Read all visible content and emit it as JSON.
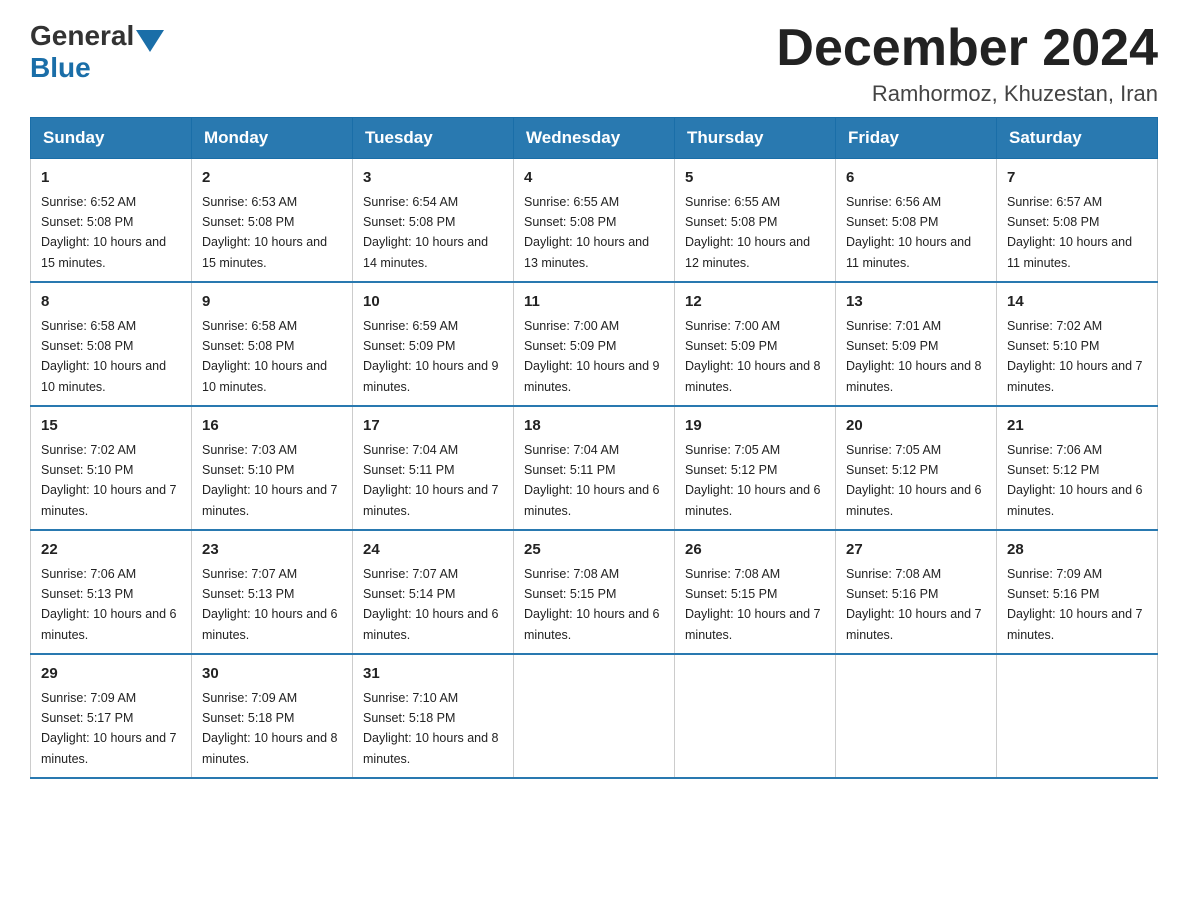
{
  "header": {
    "logo_general": "General",
    "logo_blue": "Blue",
    "title": "December 2024",
    "subtitle": "Ramhormoz, Khuzestan, Iran"
  },
  "weekdays": [
    "Sunday",
    "Monday",
    "Tuesday",
    "Wednesday",
    "Thursday",
    "Friday",
    "Saturday"
  ],
  "weeks": [
    [
      {
        "day": "1",
        "sunrise": "6:52 AM",
        "sunset": "5:08 PM",
        "daylight": "10 hours and 15 minutes."
      },
      {
        "day": "2",
        "sunrise": "6:53 AM",
        "sunset": "5:08 PM",
        "daylight": "10 hours and 15 minutes."
      },
      {
        "day": "3",
        "sunrise": "6:54 AM",
        "sunset": "5:08 PM",
        "daylight": "10 hours and 14 minutes."
      },
      {
        "day": "4",
        "sunrise": "6:55 AM",
        "sunset": "5:08 PM",
        "daylight": "10 hours and 13 minutes."
      },
      {
        "day": "5",
        "sunrise": "6:55 AM",
        "sunset": "5:08 PM",
        "daylight": "10 hours and 12 minutes."
      },
      {
        "day": "6",
        "sunrise": "6:56 AM",
        "sunset": "5:08 PM",
        "daylight": "10 hours and 11 minutes."
      },
      {
        "day": "7",
        "sunrise": "6:57 AM",
        "sunset": "5:08 PM",
        "daylight": "10 hours and 11 minutes."
      }
    ],
    [
      {
        "day": "8",
        "sunrise": "6:58 AM",
        "sunset": "5:08 PM",
        "daylight": "10 hours and 10 minutes."
      },
      {
        "day": "9",
        "sunrise": "6:58 AM",
        "sunset": "5:08 PM",
        "daylight": "10 hours and 10 minutes."
      },
      {
        "day": "10",
        "sunrise": "6:59 AM",
        "sunset": "5:09 PM",
        "daylight": "10 hours and 9 minutes."
      },
      {
        "day": "11",
        "sunrise": "7:00 AM",
        "sunset": "5:09 PM",
        "daylight": "10 hours and 9 minutes."
      },
      {
        "day": "12",
        "sunrise": "7:00 AM",
        "sunset": "5:09 PM",
        "daylight": "10 hours and 8 minutes."
      },
      {
        "day": "13",
        "sunrise": "7:01 AM",
        "sunset": "5:09 PM",
        "daylight": "10 hours and 8 minutes."
      },
      {
        "day": "14",
        "sunrise": "7:02 AM",
        "sunset": "5:10 PM",
        "daylight": "10 hours and 7 minutes."
      }
    ],
    [
      {
        "day": "15",
        "sunrise": "7:02 AM",
        "sunset": "5:10 PM",
        "daylight": "10 hours and 7 minutes."
      },
      {
        "day": "16",
        "sunrise": "7:03 AM",
        "sunset": "5:10 PM",
        "daylight": "10 hours and 7 minutes."
      },
      {
        "day": "17",
        "sunrise": "7:04 AM",
        "sunset": "5:11 PM",
        "daylight": "10 hours and 7 minutes."
      },
      {
        "day": "18",
        "sunrise": "7:04 AM",
        "sunset": "5:11 PM",
        "daylight": "10 hours and 6 minutes."
      },
      {
        "day": "19",
        "sunrise": "7:05 AM",
        "sunset": "5:12 PM",
        "daylight": "10 hours and 6 minutes."
      },
      {
        "day": "20",
        "sunrise": "7:05 AM",
        "sunset": "5:12 PM",
        "daylight": "10 hours and 6 minutes."
      },
      {
        "day": "21",
        "sunrise": "7:06 AM",
        "sunset": "5:12 PM",
        "daylight": "10 hours and 6 minutes."
      }
    ],
    [
      {
        "day": "22",
        "sunrise": "7:06 AM",
        "sunset": "5:13 PM",
        "daylight": "10 hours and 6 minutes."
      },
      {
        "day": "23",
        "sunrise": "7:07 AM",
        "sunset": "5:13 PM",
        "daylight": "10 hours and 6 minutes."
      },
      {
        "day": "24",
        "sunrise": "7:07 AM",
        "sunset": "5:14 PM",
        "daylight": "10 hours and 6 minutes."
      },
      {
        "day": "25",
        "sunrise": "7:08 AM",
        "sunset": "5:15 PM",
        "daylight": "10 hours and 6 minutes."
      },
      {
        "day": "26",
        "sunrise": "7:08 AM",
        "sunset": "5:15 PM",
        "daylight": "10 hours and 7 minutes."
      },
      {
        "day": "27",
        "sunrise": "7:08 AM",
        "sunset": "5:16 PM",
        "daylight": "10 hours and 7 minutes."
      },
      {
        "day": "28",
        "sunrise": "7:09 AM",
        "sunset": "5:16 PM",
        "daylight": "10 hours and 7 minutes."
      }
    ],
    [
      {
        "day": "29",
        "sunrise": "7:09 AM",
        "sunset": "5:17 PM",
        "daylight": "10 hours and 7 minutes."
      },
      {
        "day": "30",
        "sunrise": "7:09 AM",
        "sunset": "5:18 PM",
        "daylight": "10 hours and 8 minutes."
      },
      {
        "day": "31",
        "sunrise": "7:10 AM",
        "sunset": "5:18 PM",
        "daylight": "10 hours and 8 minutes."
      },
      null,
      null,
      null,
      null
    ]
  ]
}
